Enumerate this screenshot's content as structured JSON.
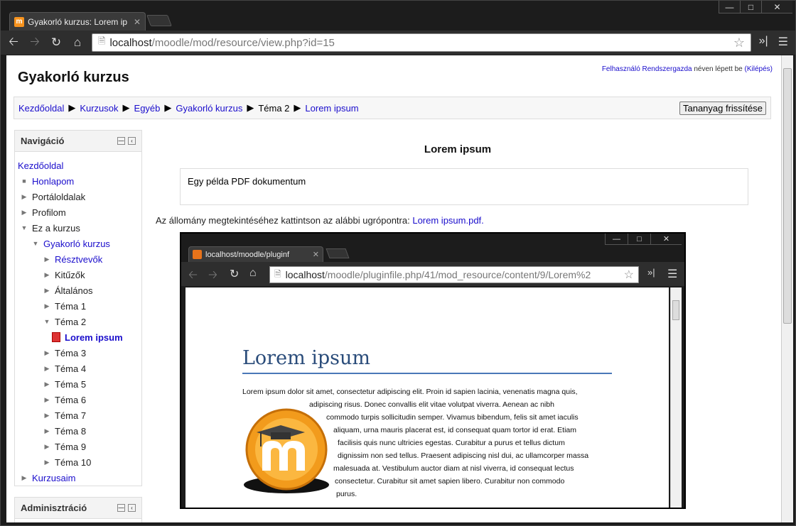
{
  "browser": {
    "tab_title": "Gyakorló kurzus: Lorem ip",
    "favicon": "m",
    "url_host": "localhost",
    "url_path": "/moodle/mod/resource/view.php?id=15"
  },
  "header": {
    "site_title": "Gyakorló kurzus",
    "login_user": "Felhasználó Rendszergazda",
    "login_text": "néven lépett be",
    "logout": "(Kilépés)"
  },
  "breadcrumb": {
    "items": [
      "Kezdőoldal",
      "Kurzusok",
      "Egyéb",
      "Gyakorló kurzus",
      "Téma 2",
      "Lorem ipsum"
    ],
    "update_button": "Tananyag frissítése"
  },
  "navigation": {
    "title": "Navigáció",
    "items": [
      "Kezdőoldal",
      "Honlapom",
      "Portáloldalak",
      "Profilom",
      "Ez a kurzus",
      "Gyakorló kurzus",
      "Résztvevők",
      "Kitűzők",
      "Általános",
      "Téma 1",
      "Téma 2",
      "Lorem ipsum",
      "Téma 3",
      "Téma 4",
      "Téma 5",
      "Téma 6",
      "Téma 7",
      "Téma 8",
      "Téma 9",
      "Téma 10",
      "Kurzusaim"
    ]
  },
  "admin": {
    "title": "Adminisztráció"
  },
  "resource": {
    "title": "Lorem ipsum",
    "intro": "Egy példa PDF dokumentum",
    "prompt": "Az állomány megtekintéséhez kattintson az alábbi ugrópontra:",
    "link": "Lorem ipsum.pdf."
  },
  "embedded": {
    "tab_title": "localhost/moodle/pluginf",
    "url_host": "localhost",
    "url_path": "/moodle/pluginfile.php/41/mod_resource/content/9/Lorem%2",
    "pdf_title": "Lorem ipsum",
    "pdf_lines": [
      "Lorem ipsum dolor sit amet, consectetur adipiscing elit. Proin id sapien lacinia, venenatis magna quis,",
      "adipiscing risus. Donec convallis elit vitae volutpat viverra. Aenean ac nibh",
      "commodo turpis sollicitudin semper. Vivamus bibendum, felis sit amet iaculis",
      "aliquam, urna mauris placerat est, id consequat quam tortor id erat. Etiam",
      "facilisis quis nunc ultricies egestas. Curabitur a purus et tellus dictum",
      "dignissim non sed tellus. Praesent adipiscing nisl dui, ac ullamcorper massa",
      "malesuada at. Vestibulum auctor diam at nisl viverra, id consequat lectus",
      "consectetur. Curabitur sit amet sapien libero. Curabitur non commodo",
      "purus."
    ]
  },
  "colors": {
    "link": "#1a0dcc",
    "pdf_title": "#2a4c7a",
    "moodle_orange": "#f7931e"
  }
}
